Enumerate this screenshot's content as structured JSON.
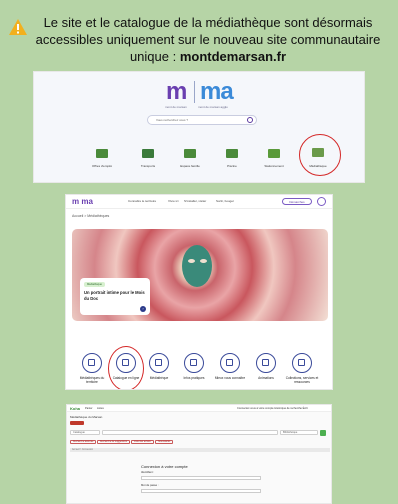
{
  "notice": {
    "line1": "Le site et le catalogue de la médiathèque sont désormais",
    "line2": "accessibles uniquement sur le nouveau site communautaire",
    "line3_prefix": "unique : ",
    "line3_bold": "montdemarsan.fr"
  },
  "shot1": {
    "logo_left": "m",
    "logo_right": "ma",
    "sub_left": "mont de marsan",
    "sub_right": "mont de marsan agglo",
    "search_placeholder": "Vous recherchez vous ?",
    "categories": [
      "Offres d'emploi",
      "Transports",
      "Espace famille",
      "Piscine",
      "Stationnement",
      "Médiathèque"
    ]
  },
  "shot2": {
    "logo": "m ma",
    "nav": [
      "Connaître le territoire",
      "Vivre ici",
      "S'installer, visiter",
      "Sortir, bouger"
    ],
    "nav_button": "Démarches",
    "breadcrumb": "Accueil  >  Médiathèques",
    "card_tag": "Médiathèque",
    "card_title": "Un portrait intime pour le Mois du Doc",
    "circles": [
      "Médiathèques du territoire",
      "Catalogue en ligne",
      "Médiathèque",
      "Infos pratiques",
      "Mieux vous connaître",
      "Animations",
      "Collections, services et ressources"
    ]
  },
  "shot3": {
    "koha": "Koha",
    "topbar": [
      "Panier",
      "Listes"
    ],
    "topbar_right": "Connectez-vous à votre compte   Historique de recherche   Écrit",
    "library": "Médiathèque du Marsan",
    "search_scope": "Catalogue",
    "search_scope_right": "Bibliothèque",
    "chips": [
      "Recherche avancée",
      "Recherche de suggestions",
      "Liste des achats",
      "Nouveautés"
    ],
    "breadcrumb": "Accueil  >  Connexion",
    "login_title": "Connexion à votre compte",
    "login_user": "Identifiant :",
    "login_pass": "Mot de passe :"
  },
  "colors": {
    "background": "#b6d4a6",
    "brand_purple": "#6a3fb0",
    "brand_blue": "#3b8ad8",
    "highlight_ring": "#d42828"
  }
}
